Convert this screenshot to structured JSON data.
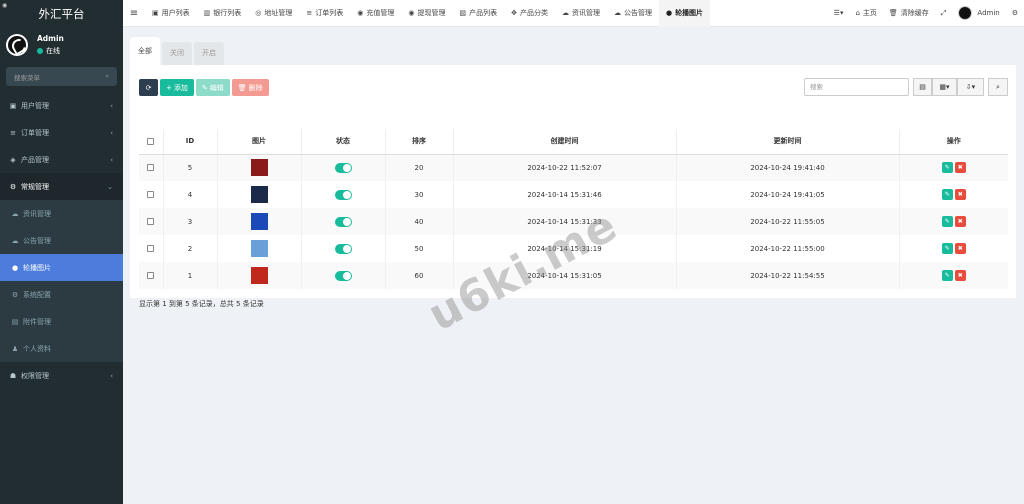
{
  "sidebar": {
    "brand": "外汇平台",
    "user": {
      "name": "Admin",
      "status": "在线"
    },
    "search_placeholder": "搜索菜单",
    "menu": [
      {
        "label": "用户管理",
        "icon": "user-icon"
      },
      {
        "label": "订单管理",
        "icon": "list-icon"
      },
      {
        "label": "产品管理",
        "icon": "product-icon"
      },
      {
        "label": "常规管理",
        "icon": "cogs-icon"
      }
    ],
    "submenu": [
      {
        "label": "资讯管理",
        "icon": "cloud-icon"
      },
      {
        "label": "公告管理",
        "icon": "cloud-icon"
      },
      {
        "label": "轮播图片",
        "icon": "play-circle-icon"
      },
      {
        "label": "系统配置",
        "icon": "cog-icon"
      },
      {
        "label": "附件管理",
        "icon": "file-image-icon"
      },
      {
        "label": "个人资料",
        "icon": "user-icon"
      }
    ],
    "menu_bottom": {
      "label": "权限管理",
      "icon": "group-icon"
    }
  },
  "topbar": {
    "tabs": [
      {
        "label": "用户列表",
        "icon": "user-icon"
      },
      {
        "label": "银行列表",
        "icon": "bank-icon"
      },
      {
        "label": "地址管理",
        "icon": "address-icon"
      },
      {
        "label": "订单列表",
        "icon": "list-icon"
      },
      {
        "label": "充值管理",
        "icon": "recharge-icon"
      },
      {
        "label": "提现管理",
        "icon": "withdraw-icon"
      },
      {
        "label": "产品列表",
        "icon": "product-icon"
      },
      {
        "label": "产品分类",
        "icon": "category-icon"
      },
      {
        "label": "资讯管理",
        "icon": "cloud-icon"
      },
      {
        "label": "公告管理",
        "icon": "cloud-icon"
      },
      {
        "label": "轮播图片",
        "icon": "play-circle-icon"
      }
    ],
    "home": "主页",
    "clear_cache": "清除缓存",
    "admin": "Admin"
  },
  "filters": [
    "全部",
    "关闭",
    "开启"
  ],
  "toolbar": {
    "add": "添加",
    "edit": "编辑",
    "delete": "删除"
  },
  "search_placeholder": "搜索",
  "table": {
    "headers": [
      "ID",
      "图片",
      "状态",
      "排序",
      "创建时间",
      "更新时间",
      "操作"
    ],
    "rows": [
      {
        "id": "5",
        "sort": "20",
        "created": "2024-10-22 11:52:07",
        "updated": "2024-10-24 19:41:40",
        "thumb": "#8b1a1a"
      },
      {
        "id": "4",
        "sort": "30",
        "created": "2024-10-14 15:31:46",
        "updated": "2024-10-24 19:41:05",
        "thumb": "#1c2a4a"
      },
      {
        "id": "3",
        "sort": "40",
        "created": "2024-10-14 15:31:33",
        "updated": "2024-10-22 11:55:05",
        "thumb": "#1a4ab8"
      },
      {
        "id": "2",
        "sort": "50",
        "created": "2024-10-14 15:31:19",
        "updated": "2024-10-22 11:55:00",
        "thumb": "#6aa0d8"
      },
      {
        "id": "1",
        "sort": "60",
        "created": "2024-10-14 15:31:05",
        "updated": "2024-10-22 11:54:55",
        "thumb": "#c0281e"
      }
    ]
  },
  "pagination_info": "显示第 1 到第 5 条记录，总共 5 条记录",
  "watermark": "u6ki.me",
  "colors": {
    "accent": "#18bc9c",
    "danger": "#e74c3c",
    "sidebar": "#222d32",
    "active_menu": "#4d7ddc"
  }
}
